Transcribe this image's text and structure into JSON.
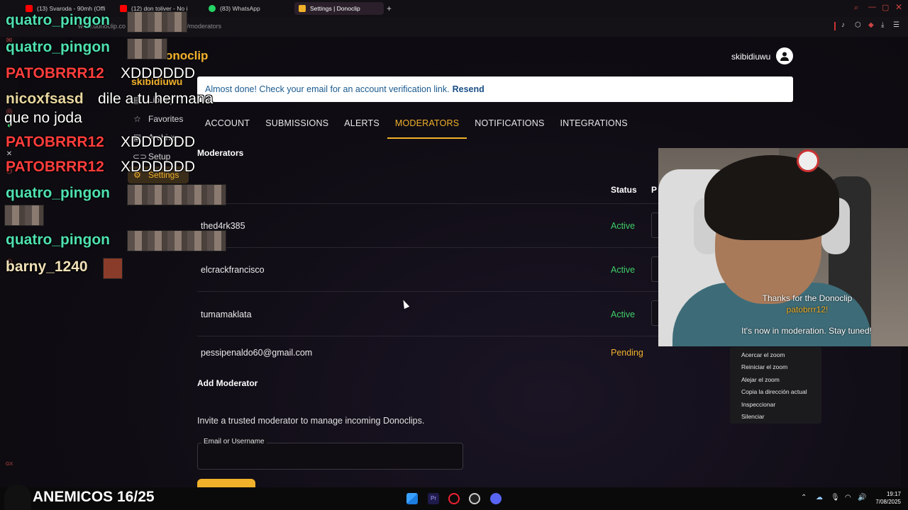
{
  "browser": {
    "tabs": [
      {
        "label": "(13) Svaroda - 90mh (Offi",
        "color": "#ff0000"
      },
      {
        "label": "(12) don toliver - No i",
        "color": "#ff0000"
      },
      {
        "label": "(83) WhatsApp",
        "color": "#25d366"
      },
      {
        "label": "Settings | Donoclip",
        "color": "#f1b12a",
        "active": true
      }
    ],
    "address": "www.donoclip.co",
    "address_tail": "gs#moderators"
  },
  "site": {
    "logo": "onoclip",
    "user": "skibidiuwu",
    "banner_text": "Almost done! Check your email for an account verification link.",
    "banner_link": "Resend"
  },
  "sidebar": {
    "username": "skibidiuwu",
    "items": [
      {
        "label": "Library",
        "icon": "library-icon"
      },
      {
        "label": "Favorites",
        "icon": "star-icon"
      },
      {
        "label": "Archive",
        "icon": "archive-icon"
      },
      {
        "label": "Setup",
        "icon": "link-icon"
      },
      {
        "label": "Settings",
        "icon": "gear-icon"
      }
    ]
  },
  "tabs": [
    "ACCOUNT",
    "SUBMISSIONS",
    "ALERTS",
    "MODERATORS",
    "NOTIFICATIONS",
    "INTEGRATIONS"
  ],
  "moderators": {
    "title": "Moderators",
    "col_status": "Status",
    "col_partial": "P",
    "rows": [
      {
        "name": "thed4rk385",
        "status": "Active"
      },
      {
        "name": "elcrackfrancisco",
        "status": "Active"
      },
      {
        "name": "tumamaklata",
        "status": "Active"
      },
      {
        "name": "pessipenaldo60@gmail.com",
        "status": "Pending"
      }
    ],
    "status_colors": {
      "Active": "#3fcf6a",
      "Pending": "#f1b12a"
    }
  },
  "add": {
    "title": "Add Moderator",
    "invite": "Invite a trusted moderator to manage incoming Donoclips.",
    "field_label": "Email or Username"
  },
  "context_menu": [
    "Acercar el zoom",
    "Reiniciar el zoom",
    "Alejar el zoom",
    "Copia la dirección actual",
    "Inspeccionar",
    "Silenciar"
  ],
  "cam": {
    "line1": "Thanks for the Donoclip",
    "line2": "patobrrr12!",
    "line3": "It's now in moderation. Stay tuned!"
  },
  "chat": [
    {
      "user": "quatro_pingon",
      "msg": ""
    },
    {
      "user": "quatro_pingon",
      "msg": ""
    },
    {
      "user": "PATOBRRR12",
      "msg": "XDDDDDD"
    },
    {
      "user": "nicoxfsasd",
      "msg": "dile a tu hermana"
    },
    {
      "user": "",
      "msg": "que no joda"
    },
    {
      "user": "PATOBRRR12",
      "msg": "XDDDDDD"
    },
    {
      "user": "PATOBRRR12",
      "msg": "XDDDDDD"
    },
    {
      "user": "quatro_pingon",
      "msg": ""
    },
    {
      "user": "quatro_pingon",
      "msg": ""
    },
    {
      "user": "barny_1240",
      "msg": ""
    }
  ],
  "subgoal": "ANEMICOS 16/25",
  "clock": {
    "time": "19:17",
    "date": "7/08/2025"
  }
}
